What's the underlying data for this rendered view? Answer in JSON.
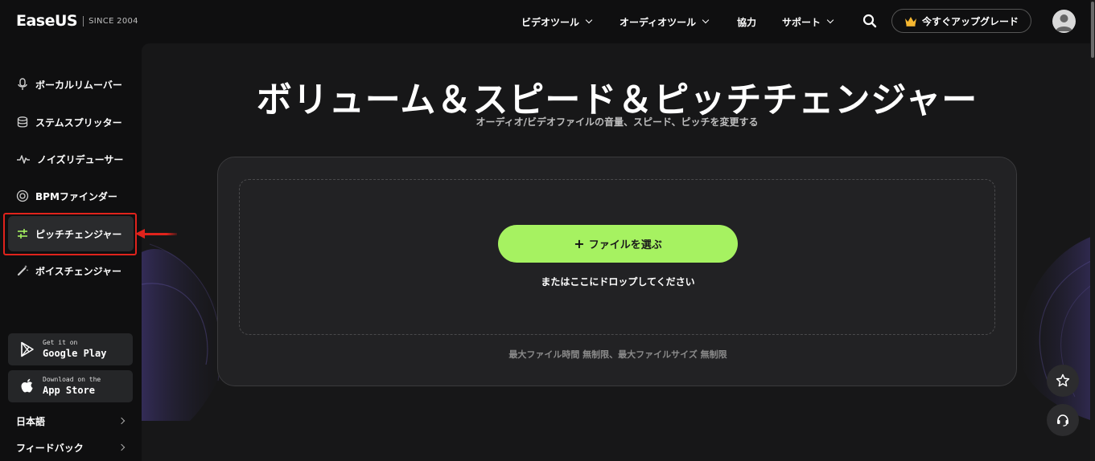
{
  "header": {
    "logo": "EaseUS",
    "since": "SINCE 2004",
    "nav": [
      {
        "label": "ビデオツール",
        "has_dropdown": true
      },
      {
        "label": "オーディオツール",
        "has_dropdown": true
      },
      {
        "label": "協力",
        "has_dropdown": false
      },
      {
        "label": "サポート",
        "has_dropdown": true
      }
    ],
    "upgrade_label": "今すぐアップグレード"
  },
  "sidebar": {
    "items": [
      {
        "label": "ボーカルリムーバー",
        "icon": "microphone-icon"
      },
      {
        "label": "ステムスプリッター",
        "icon": "stack-icon"
      },
      {
        "label": "ノイズリデューサー",
        "icon": "waveform-icon"
      },
      {
        "label": "BPMファインダー",
        "icon": "target-icon"
      },
      {
        "label": "ピッチチェンジャー",
        "icon": "sliders-icon",
        "active": true
      },
      {
        "label": "ボイスチェンジャー",
        "icon": "magic-wand-icon"
      }
    ],
    "stores": [
      {
        "small": "Get it on",
        "big": "Google Play",
        "icon": "google-play-icon"
      },
      {
        "small": "Download on the",
        "big": "App Store",
        "icon": "apple-icon"
      }
    ],
    "links": [
      {
        "label": "日本語"
      },
      {
        "label": "フィードバック"
      }
    ]
  },
  "main": {
    "title": "ボリューム＆スピード＆ピッチチェンジャー",
    "subtitle": "オーディオ/ビデオファイルの音量、スピード、ピッチを変更する",
    "choose_button": "ファイルを選ぶ",
    "drop_text": "またはここにドロップしてください",
    "limit_text": "最大ファイル時間  無制限、最大ファイルサイズ  無制限"
  },
  "colors": {
    "accent": "#a6f261",
    "highlight": "#e0231c",
    "background": "#0f0f10"
  }
}
